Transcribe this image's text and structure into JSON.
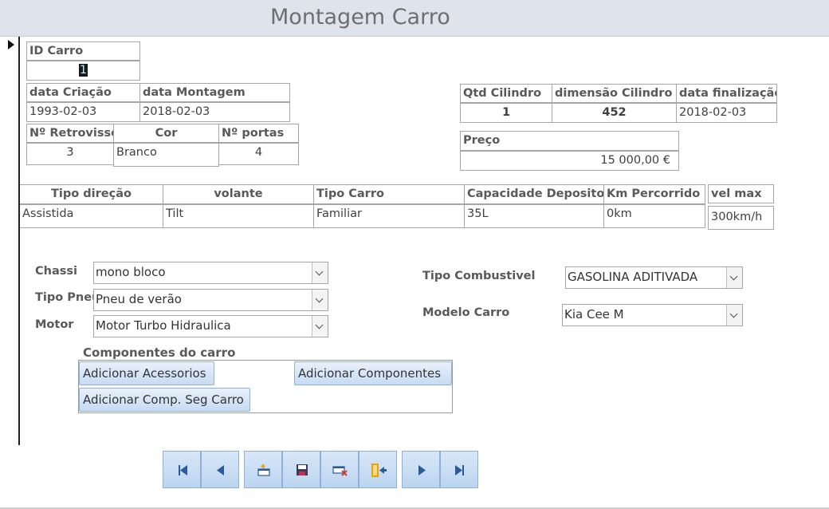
{
  "header": {
    "title": "Montagem Carro"
  },
  "fields": {
    "id_carro": {
      "label": "ID  Carro",
      "value": "1"
    },
    "data_criacao": {
      "label": "data Criação",
      "value": "1993-02-03"
    },
    "data_montagem": {
      "label": "data Montagem",
      "value": "2018-02-03"
    },
    "n_retrovisso": {
      "label": "Nº Retrovisso",
      "value": "3"
    },
    "cor": {
      "label": "Cor",
      "value": "Branco"
    },
    "n_portas": {
      "label": "Nº portas",
      "value": "4"
    },
    "qtd_cilindro": {
      "label": "Qtd Cilindro",
      "value": "1"
    },
    "dimensao_cilindro": {
      "label": "dimensão Cilindro",
      "value": "452"
    },
    "data_finalizacao": {
      "label": "data finalização",
      "value": "2018-02-03"
    },
    "preco": {
      "label": "Preço",
      "value": "15 000,00 €"
    },
    "tipo_direcao": {
      "label": "Tipo direção",
      "value": "Assistida"
    },
    "volante": {
      "label": "volante",
      "value": "Tilt"
    },
    "tipo_carro": {
      "label": "Tipo Carro",
      "value": "Familiar"
    },
    "capacidade_deposito": {
      "label": "Capacidade Deposito",
      "value": "35L"
    },
    "km_percorrido": {
      "label": "Km Percorrido",
      "value": "0km"
    },
    "vel_max": {
      "label": "vel max",
      "value": "300km/h"
    }
  },
  "combos": {
    "chassi": {
      "label": "Chassi",
      "value": "mono bloco"
    },
    "tipo_pneu": {
      "label": "Tipo Pneu",
      "value": "Pneu de verão"
    },
    "motor": {
      "label": "Motor",
      "value": "Motor Turbo Hidraulica"
    },
    "tipo_combustivel": {
      "label": "Tipo Combustivel",
      "value": "GASOLINA ADITIVADA"
    },
    "modelo_carro": {
      "label": "Modelo Carro",
      "value": "Kia Cee M"
    }
  },
  "componentes": {
    "title": "Componentes do carro",
    "add_acessorios": "Adicionar Acessorios",
    "add_componentes": "Adicionar Componentes",
    "add_comp_seg": "Adicionar Comp. Seg Carro"
  },
  "navigation": {
    "icons": [
      "first-record-icon",
      "previous-record-icon",
      "new-record-icon",
      "save-record-icon",
      "delete-record-icon",
      "close-form-icon",
      "next-record-icon",
      "last-record-icon"
    ]
  },
  "colors": {
    "header_bg": "#dfe3ec",
    "button_bg": "#c7dbf3",
    "button_border": "#8fb0d8",
    "delete_red": "#d9392b"
  }
}
